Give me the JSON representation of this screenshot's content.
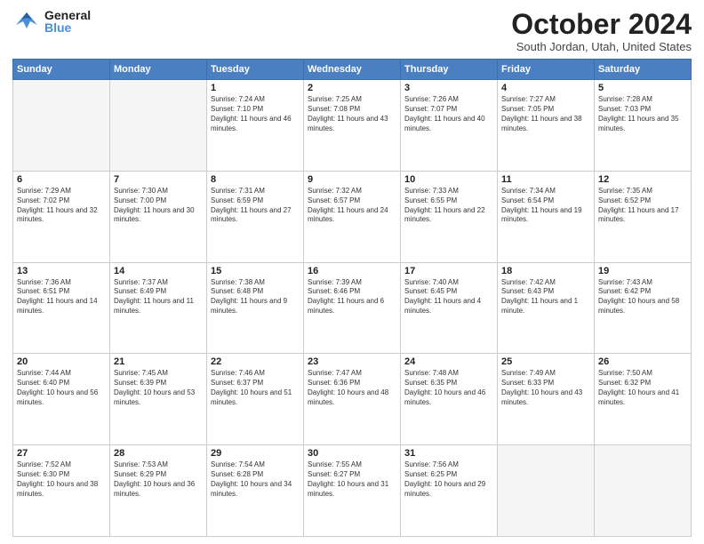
{
  "header": {
    "logo_general": "General",
    "logo_blue": "Blue",
    "month_title": "October 2024",
    "location": "South Jordan, Utah, United States"
  },
  "days_of_week": [
    "Sunday",
    "Monday",
    "Tuesday",
    "Wednesday",
    "Thursday",
    "Friday",
    "Saturday"
  ],
  "weeks": [
    [
      {
        "day": "",
        "empty": true
      },
      {
        "day": "",
        "empty": true
      },
      {
        "day": "1",
        "sunrise": "Sunrise: 7:24 AM",
        "sunset": "Sunset: 7:10 PM",
        "daylight": "Daylight: 11 hours and 46 minutes."
      },
      {
        "day": "2",
        "sunrise": "Sunrise: 7:25 AM",
        "sunset": "Sunset: 7:08 PM",
        "daylight": "Daylight: 11 hours and 43 minutes."
      },
      {
        "day": "3",
        "sunrise": "Sunrise: 7:26 AM",
        "sunset": "Sunset: 7:07 PM",
        "daylight": "Daylight: 11 hours and 40 minutes."
      },
      {
        "day": "4",
        "sunrise": "Sunrise: 7:27 AM",
        "sunset": "Sunset: 7:05 PM",
        "daylight": "Daylight: 11 hours and 38 minutes."
      },
      {
        "day": "5",
        "sunrise": "Sunrise: 7:28 AM",
        "sunset": "Sunset: 7:03 PM",
        "daylight": "Daylight: 11 hours and 35 minutes."
      }
    ],
    [
      {
        "day": "6",
        "sunrise": "Sunrise: 7:29 AM",
        "sunset": "Sunset: 7:02 PM",
        "daylight": "Daylight: 11 hours and 32 minutes."
      },
      {
        "day": "7",
        "sunrise": "Sunrise: 7:30 AM",
        "sunset": "Sunset: 7:00 PM",
        "daylight": "Daylight: 11 hours and 30 minutes."
      },
      {
        "day": "8",
        "sunrise": "Sunrise: 7:31 AM",
        "sunset": "Sunset: 6:59 PM",
        "daylight": "Daylight: 11 hours and 27 minutes."
      },
      {
        "day": "9",
        "sunrise": "Sunrise: 7:32 AM",
        "sunset": "Sunset: 6:57 PM",
        "daylight": "Daylight: 11 hours and 24 minutes."
      },
      {
        "day": "10",
        "sunrise": "Sunrise: 7:33 AM",
        "sunset": "Sunset: 6:55 PM",
        "daylight": "Daylight: 11 hours and 22 minutes."
      },
      {
        "day": "11",
        "sunrise": "Sunrise: 7:34 AM",
        "sunset": "Sunset: 6:54 PM",
        "daylight": "Daylight: 11 hours and 19 minutes."
      },
      {
        "day": "12",
        "sunrise": "Sunrise: 7:35 AM",
        "sunset": "Sunset: 6:52 PM",
        "daylight": "Daylight: 11 hours and 17 minutes."
      }
    ],
    [
      {
        "day": "13",
        "sunrise": "Sunrise: 7:36 AM",
        "sunset": "Sunset: 6:51 PM",
        "daylight": "Daylight: 11 hours and 14 minutes."
      },
      {
        "day": "14",
        "sunrise": "Sunrise: 7:37 AM",
        "sunset": "Sunset: 6:49 PM",
        "daylight": "Daylight: 11 hours and 11 minutes."
      },
      {
        "day": "15",
        "sunrise": "Sunrise: 7:38 AM",
        "sunset": "Sunset: 6:48 PM",
        "daylight": "Daylight: 11 hours and 9 minutes."
      },
      {
        "day": "16",
        "sunrise": "Sunrise: 7:39 AM",
        "sunset": "Sunset: 6:46 PM",
        "daylight": "Daylight: 11 hours and 6 minutes."
      },
      {
        "day": "17",
        "sunrise": "Sunrise: 7:40 AM",
        "sunset": "Sunset: 6:45 PM",
        "daylight": "Daylight: 11 hours and 4 minutes."
      },
      {
        "day": "18",
        "sunrise": "Sunrise: 7:42 AM",
        "sunset": "Sunset: 6:43 PM",
        "daylight": "Daylight: 11 hours and 1 minute."
      },
      {
        "day": "19",
        "sunrise": "Sunrise: 7:43 AM",
        "sunset": "Sunset: 6:42 PM",
        "daylight": "Daylight: 10 hours and 58 minutes."
      }
    ],
    [
      {
        "day": "20",
        "sunrise": "Sunrise: 7:44 AM",
        "sunset": "Sunset: 6:40 PM",
        "daylight": "Daylight: 10 hours and 56 minutes."
      },
      {
        "day": "21",
        "sunrise": "Sunrise: 7:45 AM",
        "sunset": "Sunset: 6:39 PM",
        "daylight": "Daylight: 10 hours and 53 minutes."
      },
      {
        "day": "22",
        "sunrise": "Sunrise: 7:46 AM",
        "sunset": "Sunset: 6:37 PM",
        "daylight": "Daylight: 10 hours and 51 minutes."
      },
      {
        "day": "23",
        "sunrise": "Sunrise: 7:47 AM",
        "sunset": "Sunset: 6:36 PM",
        "daylight": "Daylight: 10 hours and 48 minutes."
      },
      {
        "day": "24",
        "sunrise": "Sunrise: 7:48 AM",
        "sunset": "Sunset: 6:35 PM",
        "daylight": "Daylight: 10 hours and 46 minutes."
      },
      {
        "day": "25",
        "sunrise": "Sunrise: 7:49 AM",
        "sunset": "Sunset: 6:33 PM",
        "daylight": "Daylight: 10 hours and 43 minutes."
      },
      {
        "day": "26",
        "sunrise": "Sunrise: 7:50 AM",
        "sunset": "Sunset: 6:32 PM",
        "daylight": "Daylight: 10 hours and 41 minutes."
      }
    ],
    [
      {
        "day": "27",
        "sunrise": "Sunrise: 7:52 AM",
        "sunset": "Sunset: 6:30 PM",
        "daylight": "Daylight: 10 hours and 38 minutes."
      },
      {
        "day": "28",
        "sunrise": "Sunrise: 7:53 AM",
        "sunset": "Sunset: 6:29 PM",
        "daylight": "Daylight: 10 hours and 36 minutes."
      },
      {
        "day": "29",
        "sunrise": "Sunrise: 7:54 AM",
        "sunset": "Sunset: 6:28 PM",
        "daylight": "Daylight: 10 hours and 34 minutes."
      },
      {
        "day": "30",
        "sunrise": "Sunrise: 7:55 AM",
        "sunset": "Sunset: 6:27 PM",
        "daylight": "Daylight: 10 hours and 31 minutes."
      },
      {
        "day": "31",
        "sunrise": "Sunrise: 7:56 AM",
        "sunset": "Sunset: 6:25 PM",
        "daylight": "Daylight: 10 hours and 29 minutes."
      },
      {
        "day": "",
        "empty": true
      },
      {
        "day": "",
        "empty": true
      }
    ]
  ]
}
